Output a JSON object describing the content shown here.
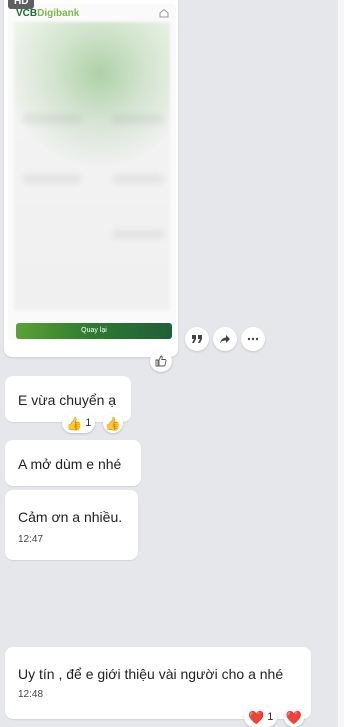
{
  "image_message": {
    "hd_badge": "HD",
    "app_brand": "VCB",
    "app_brand_suffix": "Digibank",
    "button_label": "Quay lại",
    "actions": [
      "quote-icon",
      "share-icon",
      "more-icon"
    ],
    "reaction_icon": "thumbs-up-icon"
  },
  "messages": [
    {
      "text": "E vừa chuyển ạ",
      "reaction": {
        "emoji": "👍",
        "count": "1"
      },
      "react_button_emoji": "👍"
    },
    {
      "text": "A mở dùm e nhé"
    },
    {
      "text": "Cảm ơn a nhiều.",
      "time": "12:47"
    },
    {
      "text": "Uy tín , để e giới thiệu vài người cho a nhé",
      "time": "12:48",
      "reaction": {
        "emoji": "❤️",
        "count": "1"
      },
      "react_button_emoji": "❤️"
    }
  ],
  "colors": {
    "background": "#e5e7eb",
    "bubble": "#ffffff",
    "vcb_green": "#1b6c2e",
    "heart": "#e0245e"
  }
}
